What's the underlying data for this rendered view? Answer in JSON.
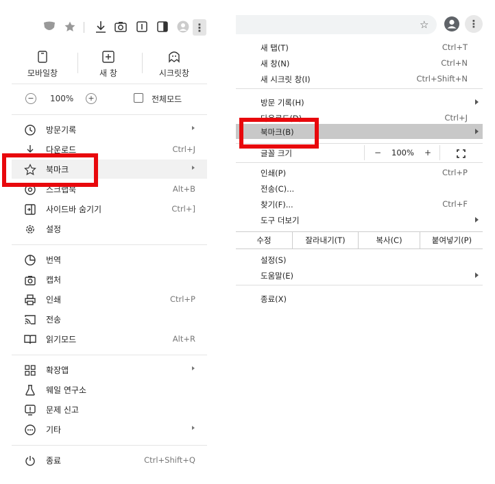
{
  "left_menu": {
    "quick_actions": [
      {
        "icon": "mobile-icon",
        "label": "모바일창"
      },
      {
        "icon": "new-window-icon",
        "label": "새 창"
      },
      {
        "icon": "secret-window-icon",
        "label": "시크릿창"
      }
    ],
    "zoom": {
      "minus": "−",
      "value": "100%",
      "plus": "+",
      "fullscreen_label": "전체모드"
    },
    "groups": [
      [
        {
          "icon": "history-icon",
          "label": "방문기록",
          "shortcut": "",
          "submenu": true
        },
        {
          "icon": "download-icon",
          "label": "다운로드",
          "shortcut": "Ctrl+J",
          "submenu": false
        },
        {
          "icon": "star-icon",
          "label": "북마크",
          "shortcut": "",
          "submenu": true
        },
        {
          "icon": "screenshot-icon",
          "label": "스크랩북",
          "shortcut": "Alt+B",
          "submenu": false
        },
        {
          "icon": "sidebar-icon",
          "label": "사이드바 숨기기",
          "shortcut": "Ctrl+]",
          "submenu": false
        },
        {
          "icon": "gear-icon",
          "label": "설정",
          "shortcut": "",
          "submenu": false
        }
      ],
      [
        {
          "icon": "translate-icon",
          "label": "번역",
          "shortcut": "",
          "submenu": false
        },
        {
          "icon": "camera-icon",
          "label": "캡처",
          "shortcut": "",
          "submenu": false
        },
        {
          "icon": "print-icon",
          "label": "인쇄",
          "shortcut": "Ctrl+P",
          "submenu": false
        },
        {
          "icon": "cast-icon",
          "label": "전송",
          "shortcut": "",
          "submenu": false
        },
        {
          "icon": "book-icon",
          "label": "읽기모드",
          "shortcut": "Alt+R",
          "submenu": false
        }
      ],
      [
        {
          "icon": "extensions-icon",
          "label": "확장앱",
          "shortcut": "",
          "submenu": true
        },
        {
          "icon": "lab-icon",
          "label": "웨일 연구소",
          "shortcut": "",
          "submenu": false
        },
        {
          "icon": "report-icon",
          "label": "문제 신고",
          "shortcut": "",
          "submenu": false
        },
        {
          "icon": "more-circle-icon",
          "label": "기타",
          "shortcut": "",
          "submenu": true
        }
      ],
      [
        {
          "icon": "power-icon",
          "label": "종료",
          "shortcut": "Ctrl+Shift+Q",
          "submenu": false
        }
      ]
    ]
  },
  "right_menu": {
    "items_top": [
      {
        "label": "새 탭(T)",
        "shortcut": "Ctrl+T"
      },
      {
        "label": "새 창(N)",
        "shortcut": "Ctrl+N"
      },
      {
        "label": "새 시크릿 창(I)",
        "shortcut": "Ctrl+Shift+N"
      }
    ],
    "history": {
      "label": "방문 기록(H)"
    },
    "downloads": {
      "label": "다운로드(D)",
      "shortcut": "Ctrl+J"
    },
    "bookmarks": {
      "label": "북마크(B)"
    },
    "zoom": {
      "label": "글꼴 크기",
      "minus": "−",
      "value": "100%",
      "plus": "+"
    },
    "items_mid": [
      {
        "label": "인쇄(P)",
        "shortcut": "Ctrl+P"
      },
      {
        "label": "전송(C)...",
        "shortcut": ""
      },
      {
        "label": "찾기(F)...",
        "shortcut": "Ctrl+F"
      }
    ],
    "more_tools": {
      "label": "도구 더보기"
    },
    "edit": {
      "label": "수정",
      "cut": "잘라내기(T)",
      "copy": "복사(C)",
      "paste": "붙여넣기(P)"
    },
    "settings": {
      "label": "설정(S)"
    },
    "help": {
      "label": "도움말(E)"
    },
    "exit": {
      "label": "종료(X)"
    }
  },
  "colors": {
    "highlight_box": "#e8080c",
    "selected_row": "#c8c8c8"
  }
}
